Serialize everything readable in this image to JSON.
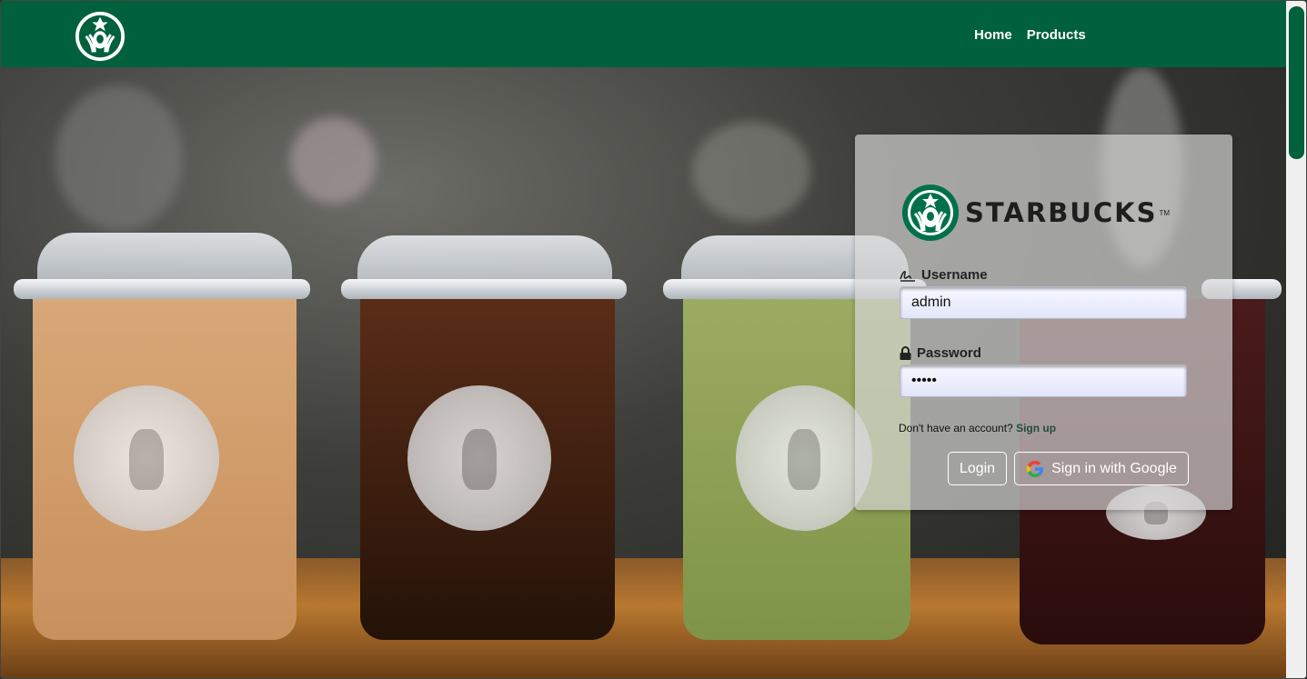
{
  "navbar": {
    "logo_icon": "starbucks-siren-logo",
    "links": [
      {
        "label": "Home"
      },
      {
        "label": "Products"
      }
    ],
    "color": "#00613c"
  },
  "login": {
    "brand_icon": "starbucks-siren-logo",
    "brand_name": "STARBUCKS",
    "brand_tm": "TM",
    "username_label": "Username",
    "username_icon": "signature-icon",
    "username_value": "admin",
    "password_label": "Password",
    "password_icon": "lock-icon",
    "password_value": "•••••",
    "signup_prompt": "Don't have an account?",
    "signup_link": "Sign up",
    "login_button": "Login",
    "google_button": "Sign in with Google",
    "google_icon": "google-g-icon"
  },
  "colors": {
    "brand_green": "#00613c",
    "scrollbar_thumb": "#00613c"
  }
}
